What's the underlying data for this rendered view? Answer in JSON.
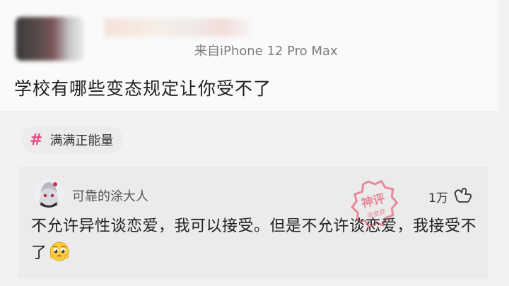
{
  "post": {
    "device_label": "来自iPhone 12 Pro Max",
    "title": "学校有哪些变态规定让你受不了"
  },
  "topic": {
    "label": "满满正能量"
  },
  "comment": {
    "username": "可靠的涂大人",
    "like_count": "1万",
    "text": "不允许异性谈恋爱，我可以接受。但是不允许谈恋爱，我接受不了",
    "emoji": "pleading-face-emoji"
  },
  "watermark": {
    "line1": "神评",
    "line2": "皮皮虾"
  },
  "colors": {
    "tag_accent": "#ea4c89",
    "watermark": "#e57a8e"
  }
}
